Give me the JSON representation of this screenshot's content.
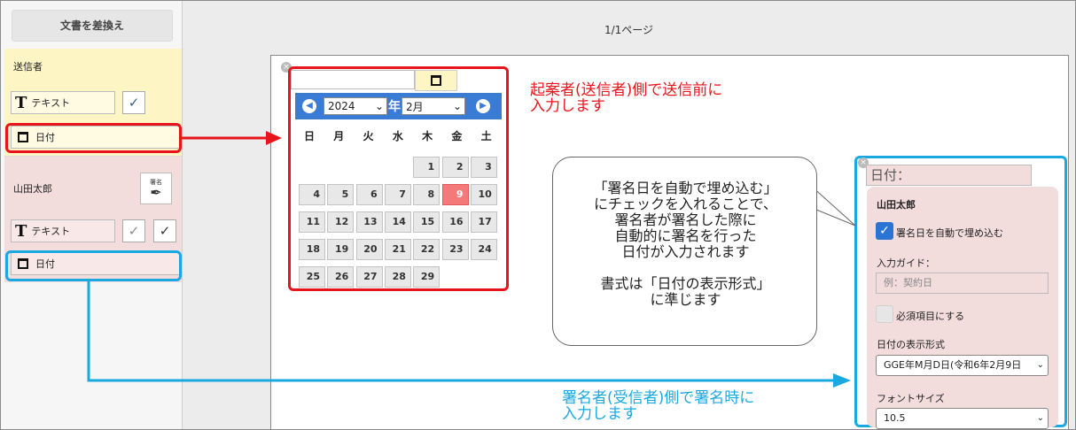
{
  "sidebar": {
    "swap_button": "文書を差換え",
    "sender": {
      "title": "送信者",
      "text_field": "テキスト",
      "date_field": "日付"
    },
    "signer": {
      "name": "山田太郎",
      "sign_label": "署名",
      "text_field": "テキスト",
      "date_field": "日付"
    }
  },
  "main": {
    "page_indicator": "1/1ページ"
  },
  "calendar": {
    "year": "2024",
    "year_suffix": "年",
    "month": "2月",
    "prev_icon": "◀",
    "next_icon": "▶",
    "weekdays": [
      "日",
      "月",
      "火",
      "水",
      "木",
      "金",
      "土"
    ],
    "days": [
      "1",
      "2",
      "3",
      "4",
      "5",
      "6",
      "7",
      "8",
      "9",
      "10",
      "11",
      "12",
      "13",
      "14",
      "15",
      "16",
      "17",
      "18",
      "19",
      "20",
      "21",
      "22",
      "23",
      "24",
      "25",
      "26",
      "27",
      "28",
      "29"
    ],
    "today": "9",
    "first_weekday_index": 4
  },
  "annotations": {
    "red_note": [
      "起案者(送信者)側で送信前に",
      "入力します"
    ],
    "blue_note": [
      "署名者(受信者)側で署名時に",
      "入力します"
    ],
    "bubble": [
      "「署名日を自動で埋め込む」",
      "にチェックを入れることで、",
      "署名者が署名した際に",
      "自動的に署名を行った",
      "日付が入力されます",
      "",
      "書式は「日付の表示形式」",
      "に準じます"
    ]
  },
  "field_settings": {
    "field_label": "日付：",
    "signer_name": "山田太郎",
    "auto_date_label": "署名日を自動で埋め込む",
    "auto_date_checked": true,
    "input_guide_label": "入力ガイド：",
    "input_guide_placeholder": "例：契約日",
    "required_label": "必須項目にする",
    "required_checked": false,
    "date_format_label": "日付の表示形式",
    "date_format_value": "GGE年M月D日(令和6年2月9日",
    "font_size_label": "フォントサイズ",
    "font_size_value": "10.5"
  },
  "colors": {
    "accent_blue": "#1aa8e0",
    "highlight_red": "#e8141c",
    "calendar_header": "#3a7bd5",
    "sender_bg": "#fdf6c4",
    "signer_bg": "#f3dcdc"
  }
}
